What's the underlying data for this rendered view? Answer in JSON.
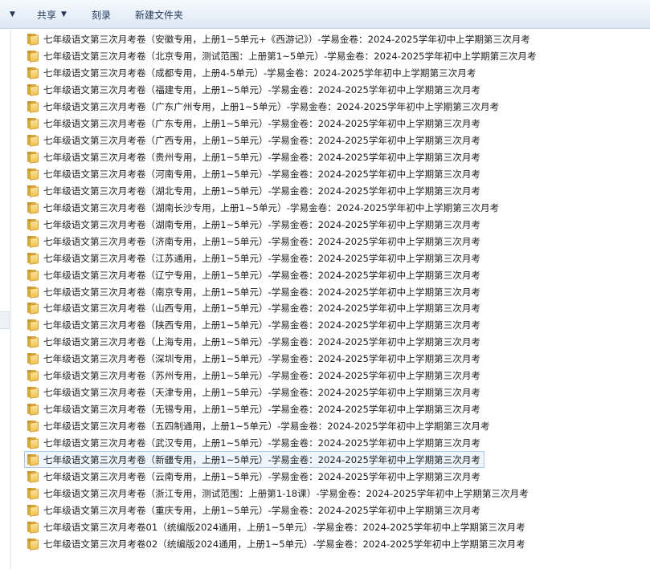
{
  "toolbar": {
    "share_label": "共享",
    "burn_label": "刻录",
    "new_folder_label": "新建文件夹"
  },
  "files": [
    "七年级语文第三次月考卷（安徽专用，上册1~5单元+《西游记》）-学易金卷：2024-2025学年初中上学期第三次月考",
    "七年级语文第三次月考卷（北京专用，测试范围：上册第1~5单元）-学易金卷：2024-2025学年初中上学期第三次月考",
    "七年级语文第三次月考卷（成都专用，上册4-5单元）-学易金卷：2024-2025学年初中上学期第三次月考",
    "七年级语文第三次月考卷（福建专用，上册1~5单元）-学易金卷：2024-2025学年初中上学期第三次月考",
    "七年级语文第三次月考卷（广东广州专用，上册1~5单元）-学易金卷：2024-2025学年初中上学期第三次月考",
    "七年级语文第三次月考卷（广东专用，上册1~5单元）-学易金卷：2024-2025学年初中上学期第三次月考",
    "七年级语文第三次月考卷（广西专用，上册1~5单元）-学易金卷：2024-2025学年初中上学期第三次月考",
    "七年级语文第三次月考卷（贵州专用，上册1~5单元）-学易金卷：2024-2025学年初中上学期第三次月考",
    "七年级语文第三次月考卷（河南专用，上册1~5单元）-学易金卷：2024-2025学年初中上学期第三次月考",
    "七年级语文第三次月考卷（湖北专用，上册1~5单元）-学易金卷：2024-2025学年初中上学期第三次月考",
    "七年级语文第三次月考卷（湖南长沙专用，上册1~5单元）-学易金卷：2024-2025学年初中上学期第三次月考",
    "七年级语文第三次月考卷（湖南专用，上册1~5单元）-学易金卷：2024-2025学年初中上学期第三次月考",
    "七年级语文第三次月考卷（济南专用，上册1~5单元）-学易金卷：2024-2025学年初中上学期第三次月考",
    "七年级语文第三次月考卷（江苏通用，上册1~5单元）-学易金卷：2024-2025学年初中上学期第三次月考",
    "七年级语文第三次月考卷（辽宁专用，上册1~5单元）-学易金卷：2024-2025学年初中上学期第三次月考",
    "七年级语文第三次月考卷（南京专用，上册1~5单元）-学易金卷：2024-2025学年初中上学期第三次月考",
    "七年级语文第三次月考卷（山西专用，上册1~5单元）-学易金卷：2024-2025学年初中上学期第三次月考",
    "七年级语文第三次月考卷（陕西专用，上册1~5单元）-学易金卷：2024-2025学年初中上学期第三次月考",
    "七年级语文第三次月考卷（上海专用，上册1~5单元）-学易金卷：2024-2025学年初中上学期第三次月考",
    "七年级语文第三次月考卷（深圳专用，上册1~5单元）-学易金卷：2024-2025学年初中上学期第三次月考",
    "七年级语文第三次月考卷（苏州专用，上册1~5单元）-学易金卷：2024-2025学年初中上学期第三次月考",
    "七年级语文第三次月考卷（天津专用，上册1~5单元）-学易金卷：2024-2025学年初中上学期第三次月考",
    "七年级语文第三次月考卷（无锡专用，上册1~5单元）-学易金卷：2024-2025学年初中上学期第三次月考",
    "七年级语文第三次月考卷（五四制通用，上册1~5单元）-学易金卷：2024-2025学年初中上学期第三次月考",
    "七年级语文第三次月考卷（武汉专用，上册1~5单元）-学易金卷：2024-2025学年初中上学期第三次月考",
    "七年级语文第三次月考卷（新疆专用，上册1~5单元）-学易金卷：2024-2025学年初中上学期第三次月考",
    "七年级语文第三次月考卷（云南专用，上册1~5单元）-学易金卷：2024-2025学年初中上学期第三次月考",
    "七年级语文第三次月考卷（浙江专用，测试范围：上册第1-18课）-学易金卷：2024-2025学年初中上学期第三次月考",
    "七年级语文第三次月考卷（重庆专用，上册1~5单元）-学易金卷：2024-2025学年初中上学期第三次月考",
    "七年级语文第三次月考卷01（统编版2024通用，上册1~5单元）-学易金卷：2024-2025学年初中上学期第三次月考",
    "七年级语文第三次月考卷02（统编版2024通用，上册1~5单元）-学易金卷：2024-2025学年初中上学期第三次月考"
  ],
  "selected_index": 25
}
